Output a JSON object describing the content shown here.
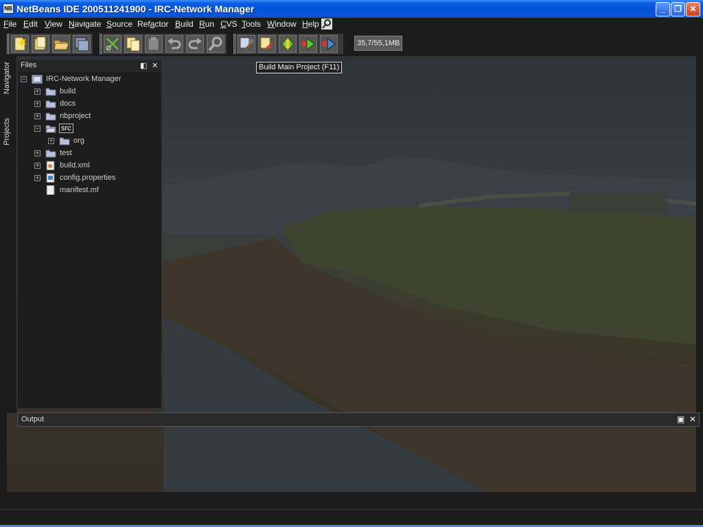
{
  "window": {
    "title": "NetBeans IDE 200511241900 - IRC-Network Manager",
    "app_icon_text": "NB",
    "minimize": "_",
    "maximize": "❐",
    "close": "✕"
  },
  "menu": [
    {
      "label": "File",
      "u": "F",
      "rest": "ile"
    },
    {
      "label": "Edit",
      "u": "E",
      "rest": "dit"
    },
    {
      "label": "View",
      "u": "V",
      "rest": "iew"
    },
    {
      "label": "Navigate",
      "u": "N",
      "rest": "avigate"
    },
    {
      "label": "Source",
      "u": "S",
      "rest": "ource"
    },
    {
      "label": "Refactor",
      "pre": "Ref",
      "u": "a",
      "rest": "ctor"
    },
    {
      "label": "Build",
      "u": "B",
      "rest": "uild"
    },
    {
      "label": "Run",
      "u": "R",
      "rest": "un"
    },
    {
      "label": "CVS",
      "u": "C",
      "rest": "VS"
    },
    {
      "label": "Tools",
      "u": "T",
      "rest": "ools"
    },
    {
      "label": "Window",
      "u": "W",
      "rest": "indow"
    },
    {
      "label": "Help",
      "u": "H",
      "rest": "elp"
    }
  ],
  "toolbar": {
    "memory": "35,7/55,1MB",
    "tooltip": "Build Main Project (F11)",
    "buttons": [
      "new-file",
      "new-project",
      "open-project",
      "save-all",
      "cut",
      "copy",
      "paste",
      "undo",
      "redo",
      "find",
      "build-main-project",
      "clean-build",
      "debug-main-project",
      "run-main-project",
      "run-file"
    ]
  },
  "left_rail": {
    "navigator": "Navigator",
    "projects": "Projects"
  },
  "files_panel": {
    "title": "Files",
    "tree": [
      {
        "label": "IRC-Network Manager",
        "level": 0,
        "expanded": true,
        "type": "project"
      },
      {
        "label": "build",
        "level": 1,
        "expanded": false,
        "type": "folder"
      },
      {
        "label": "docs",
        "level": 1,
        "expanded": false,
        "type": "folder"
      },
      {
        "label": "nbproject",
        "level": 1,
        "expanded": false,
        "type": "folder"
      },
      {
        "label": "src",
        "level": 1,
        "expanded": true,
        "type": "folder-open",
        "selected": true
      },
      {
        "label": "org",
        "level": 2,
        "expanded": false,
        "type": "folder"
      },
      {
        "label": "test",
        "level": 1,
        "expanded": false,
        "type": "folder"
      },
      {
        "label": "build.xml",
        "level": 1,
        "expanded": false,
        "type": "xml"
      },
      {
        "label": "config.properties",
        "level": 1,
        "expanded": false,
        "type": "properties"
      },
      {
        "label": "manifest.mf",
        "level": 1,
        "leaf": true,
        "type": "file"
      }
    ]
  },
  "output_panel": {
    "title": "Output"
  },
  "colors": {
    "titlebar": "#0452d6",
    "background": "#1c1c1c",
    "panel": "#1d1d1d"
  }
}
